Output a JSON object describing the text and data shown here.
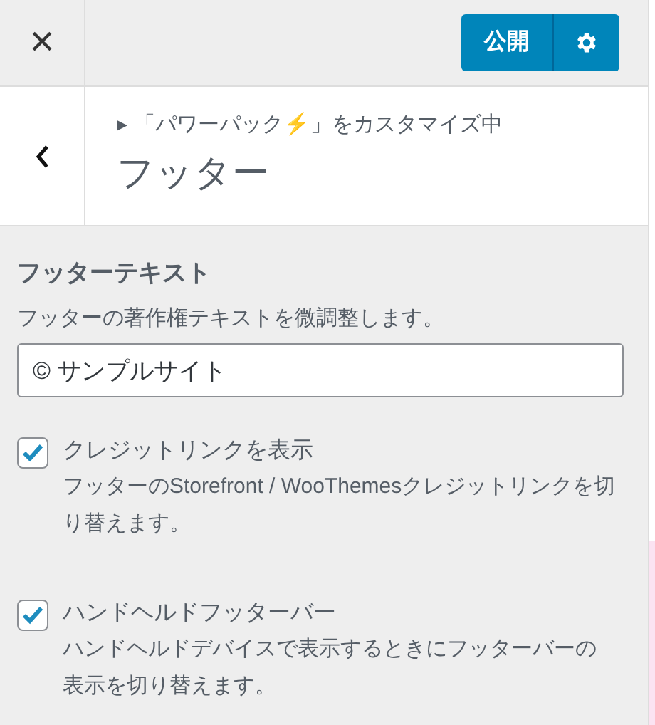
{
  "top_bar": {
    "close": "×",
    "publish": "公開"
  },
  "header": {
    "breadcrumb": "▸ 「パワーパック⚡」をカスタマイズ中",
    "title": "フッター"
  },
  "footer_text": {
    "label": "フッターテキスト",
    "description": "フッターの著作権テキストを微調整します。",
    "value": "© サンプルサイト"
  },
  "options": [
    {
      "label": "クレジットリンクを表示",
      "description": "フッターのStorefront / WooThemesクレジットリンクを切り替えます。",
      "checked": true
    },
    {
      "label": "ハンドヘルドフッターバー",
      "description": "ハンドヘルドデバイスで表示するときにフッターバーの表示を切り替えます。",
      "checked": true
    }
  ]
}
